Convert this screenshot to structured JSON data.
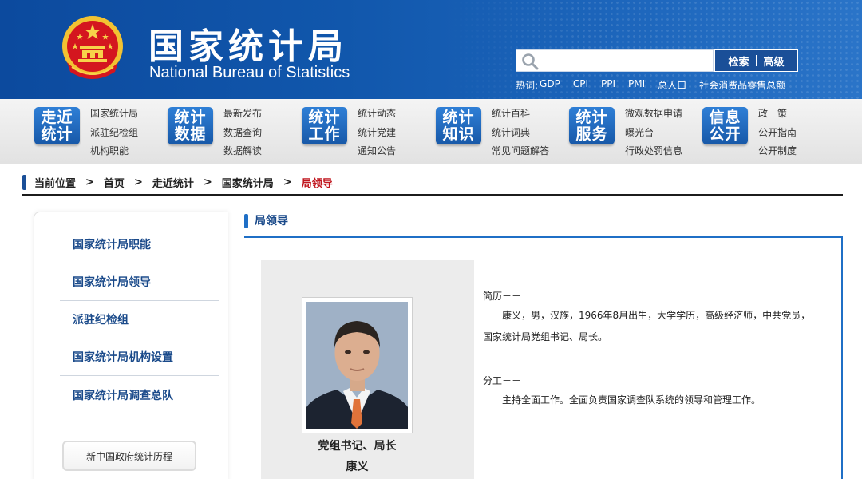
{
  "header": {
    "title_cn": "国家统计局",
    "title_en": "National Bureau of Statistics",
    "search": {
      "placeholder": "",
      "search_label": "检索",
      "advanced_label": "高级"
    },
    "hot_label": "热词:",
    "hot_items": [
      "GDP",
      "CPI",
      "PPI",
      "PMI",
      "总人口",
      "社会消费品零售总额"
    ]
  },
  "nav": [
    {
      "badge": [
        "走近",
        "统计"
      ],
      "links": [
        "国家统计局",
        "派驻纪检组",
        "机构职能"
      ]
    },
    {
      "badge": [
        "统计",
        "数据"
      ],
      "links": [
        "最新发布",
        "数据查询",
        "数据解读"
      ]
    },
    {
      "badge": [
        "统计",
        "工作"
      ],
      "links": [
        "统计动态",
        "统计党建",
        "通知公告"
      ]
    },
    {
      "badge": [
        "统计",
        "知识"
      ],
      "links": [
        "统计百科",
        "统计词典",
        "常见问题解答"
      ]
    },
    {
      "badge": [
        "统计",
        "服务"
      ],
      "links": [
        "微观数据申请",
        "曝光台",
        "行政处罚信息"
      ]
    },
    {
      "badge": [
        "信息",
        "公开"
      ],
      "links": [
        "政　策",
        "公开指南",
        "公开制度"
      ]
    }
  ],
  "breadcrumb": {
    "label": "当前位置",
    "items": [
      "首页",
      "走近统计",
      "国家统计局"
    ],
    "current": "局领导"
  },
  "sidebar": {
    "items": [
      "国家统计局职能",
      "国家统计局领导",
      "派驻纪检组",
      "国家统计局机构设置",
      "国家统计局调查总队"
    ],
    "button": "新中国政府统计历程"
  },
  "main": {
    "section_title": "局领导",
    "profile": {
      "role": "党组书记、局长",
      "name": "康义"
    },
    "bio": {
      "resume_heading": "简历－－",
      "resume_text": "康义，男，汉族，1966年8月出生，大学学历，高级经济师，中共党员，国家统计局党组书记、局长。",
      "duty_heading": "分工－－",
      "duty_text": "主持全面工作。全面负责国家调查队系统的领导和管理工作。"
    }
  },
  "colors": {
    "header_blue": "#0c4a9e",
    "nav_badge_blue": "#1758a8",
    "link_blue": "#1a4a8a",
    "current_red": "#c0161e"
  }
}
